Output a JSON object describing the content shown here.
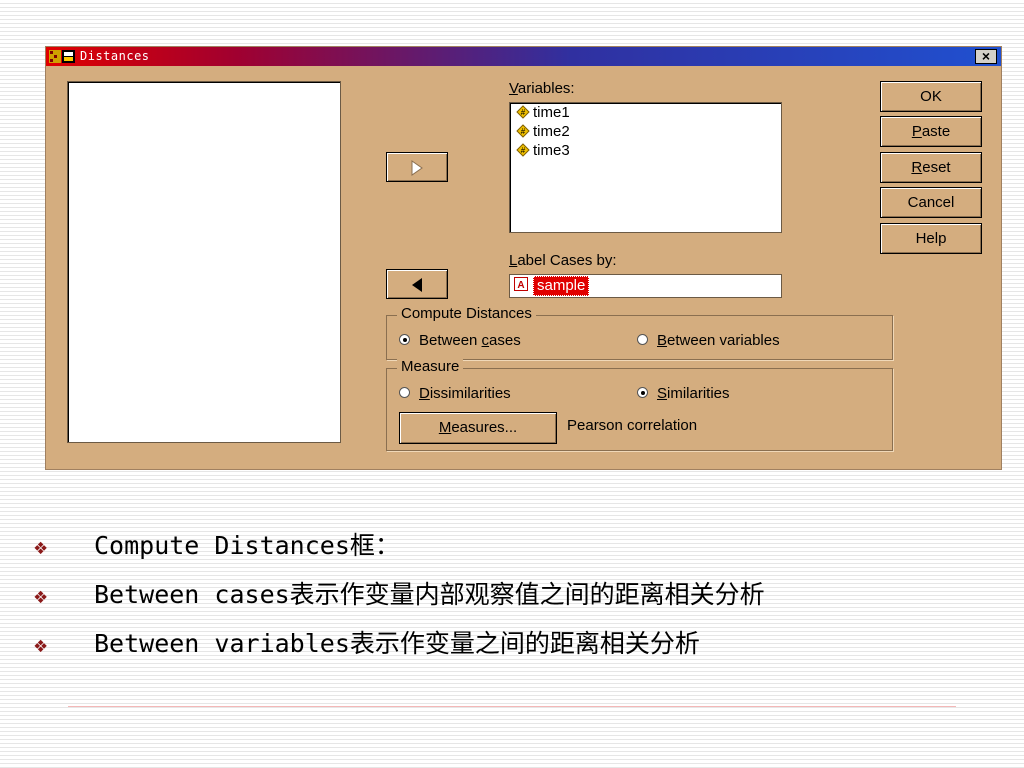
{
  "window": {
    "title": "Distances",
    "close_label": "×"
  },
  "variables_label_pre": "",
  "variables_label_u": "V",
  "variables_label_post": "ariables:",
  "variables": [
    "time1",
    "time2",
    "time3"
  ],
  "label_cases_u": "L",
  "label_cases_post": "abel Cases by:",
  "label_cases_value": "sample",
  "buttons": {
    "ok": "OK",
    "paste_u": "P",
    "paste_rest": "aste",
    "reset_u": "R",
    "reset_rest": "eset",
    "cancel": "Cancel",
    "help": "Help"
  },
  "compute_distances": {
    "title": "Compute Distances",
    "between_cases_pre": "Between ",
    "between_cases_u": "c",
    "between_cases_post": "ases",
    "between_variables_u": "B",
    "between_variables_post": "etween variables",
    "selected": "between_cases"
  },
  "measure": {
    "title": "Measure",
    "dissimilarities_u": "D",
    "dissimilarities_post": "issimilarities",
    "similarities_u": "S",
    "similarities_post": "imilarities",
    "selected": "similarities",
    "measures_button_u": "M",
    "measures_button_post": "easures...",
    "measure_text": "Pearson correlation"
  },
  "bullets": [
    "Compute Distances框：",
    "Between cases表示作变量内部观察值之间的距离相关分析",
    "Between variables表示作变量之间的距离相关分析"
  ],
  "colors": {
    "dialog_bg": "#d4ad7f",
    "bullet": "#8b1a1a",
    "selection": "#e00000"
  }
}
